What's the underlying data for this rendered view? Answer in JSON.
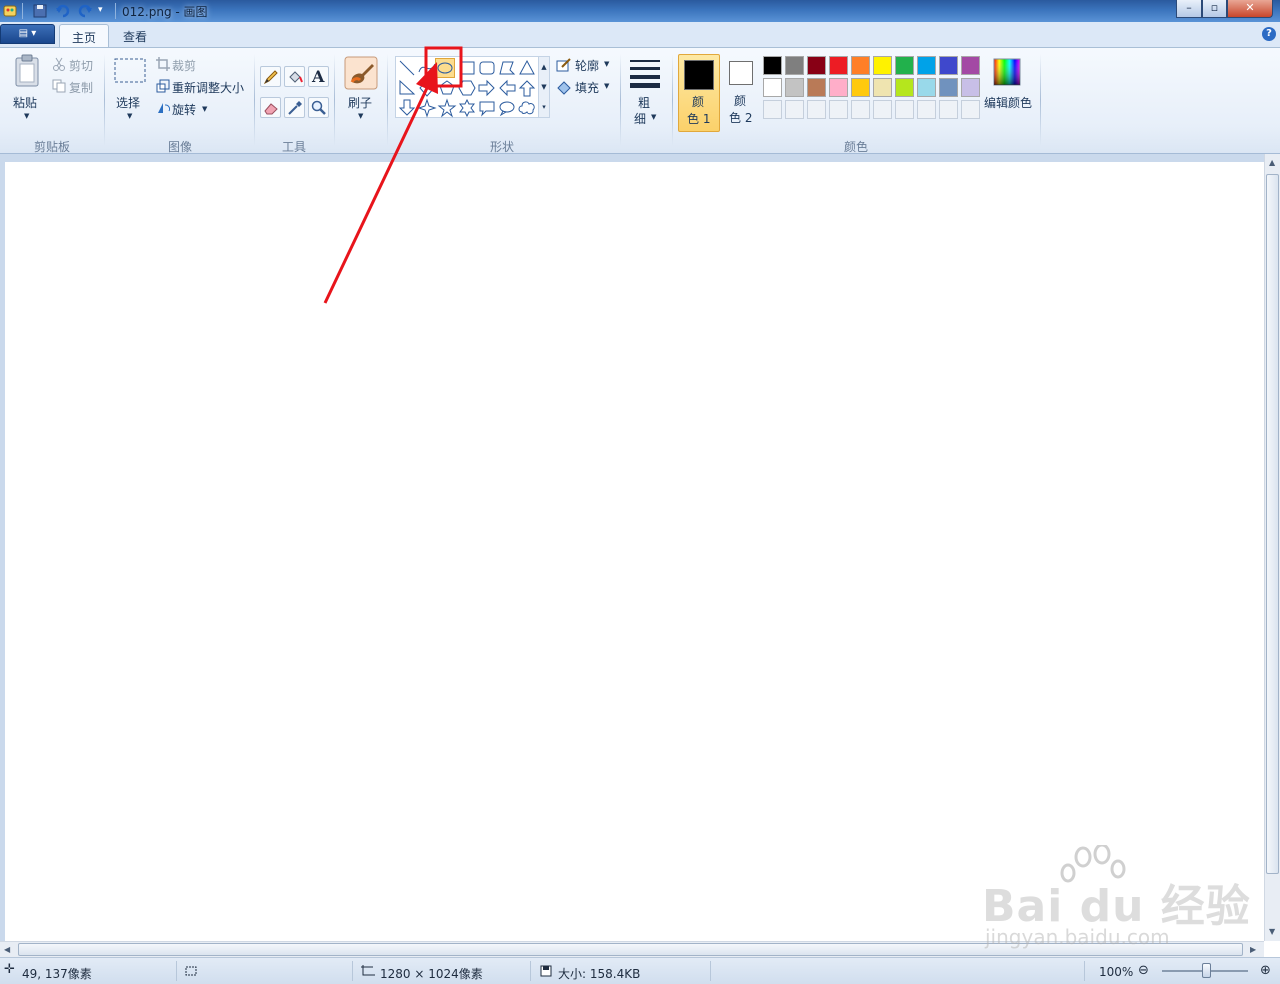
{
  "window": {
    "title": "012.png - 画图",
    "minimize": "–",
    "maximize": "▫",
    "close": "✕"
  },
  "tabs": [
    {
      "label": "主页",
      "active": true
    },
    {
      "label": "查看",
      "active": false
    }
  ],
  "app_menu": "▤ ▾",
  "help": "?",
  "clipboard": {
    "paste": "粘贴",
    "cut": "剪切",
    "copy": "复制",
    "label": "剪贴板"
  },
  "image": {
    "select": "选择",
    "crop": "裁剪",
    "resize": "重新调整大小",
    "rotate": "旋转",
    "label": "图像"
  },
  "tools": {
    "items": [
      "pencil-icon",
      "fill-bucket-icon",
      "text-icon",
      "eraser-icon",
      "color-picker-icon",
      "magnifier-icon"
    ],
    "text_glyph": "A",
    "label": "工具"
  },
  "brushes": {
    "label": "刷子"
  },
  "shapes": {
    "label": "形状",
    "outline": "轮廓",
    "fill": "填充",
    "selected": "oval"
  },
  "size": {
    "line1": "粗",
    "line2": "细"
  },
  "colors": {
    "color1_line1": "颜",
    "color1_line2": "色 1",
    "color2_line1": "颜",
    "color2_line2": "色 2",
    "color1_value": "#000000",
    "color2_value": "#ffffff",
    "edit": "编辑颜色",
    "label": "颜色",
    "palette_row1": [
      "#000000",
      "#7f7f7f",
      "#880015",
      "#ed1c24",
      "#ff7f27",
      "#fff200",
      "#22b14c",
      "#00a2e8",
      "#3f48cc",
      "#a349a4"
    ],
    "palette_row2": [
      "#ffffff",
      "#c3c3c3",
      "#b97a57",
      "#ffaec9",
      "#ffc90e",
      "#efe4b0",
      "#b5e61d",
      "#99d9ea",
      "#7092be",
      "#c8bfe7"
    ]
  },
  "status": {
    "cursor_pos": "49, 137像素",
    "image_size": "1280 × 1024像素",
    "file_size": "大小: 158.4KB",
    "zoom": "100%"
  },
  "watermark": {
    "brand": "Bai du 经验",
    "url": "jingyan.baidu.com"
  },
  "annotation": {
    "color": "#e8141b"
  }
}
